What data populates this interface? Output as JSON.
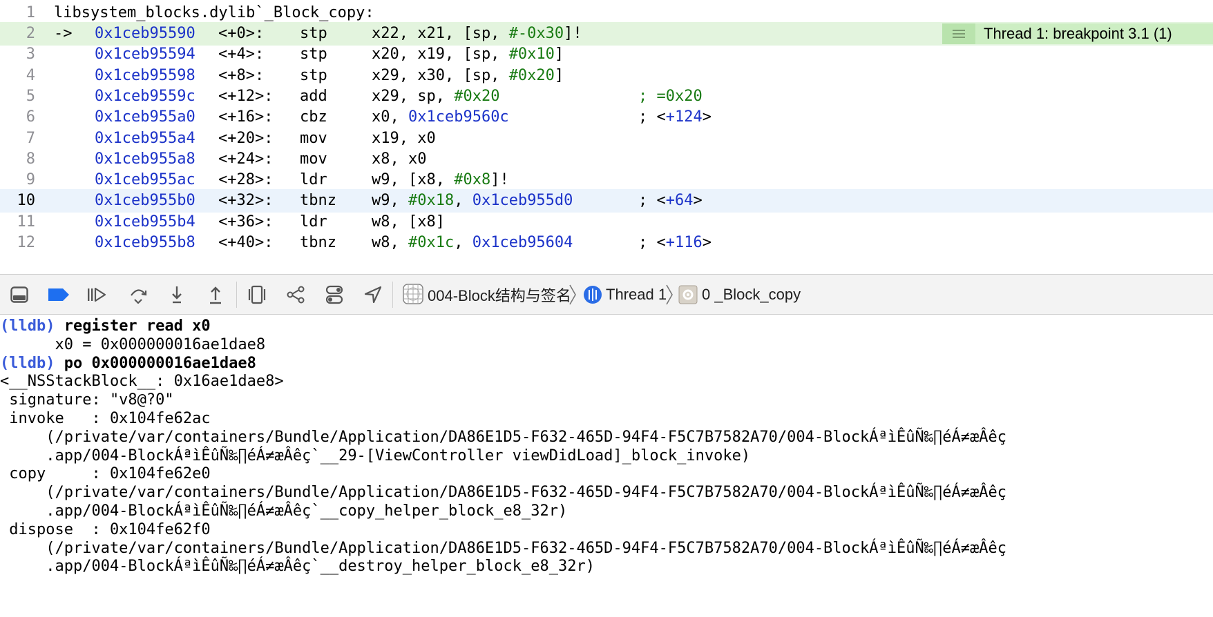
{
  "editor": {
    "header": {
      "line": "1",
      "text": "libsystem_blocks.dylib`_Block_copy:"
    },
    "pc_arrow": "->",
    "breakpoint_badge": "Thread 1: breakpoint 3.1 (1)",
    "rows": [
      {
        "line": "2",
        "addr": "0x1ceb95590",
        "offset": "<+0>:",
        "mnemonic": "stp",
        "ops": [
          "x22, x21, [sp, ",
          "#-0x30",
          "]!"
        ],
        "comment": ""
      },
      {
        "line": "3",
        "addr": "0x1ceb95594",
        "offset": "<+4>:",
        "mnemonic": "stp",
        "ops": [
          "x20, x19, [sp, ",
          "#0x10",
          "]"
        ],
        "comment": ""
      },
      {
        "line": "4",
        "addr": "0x1ceb95598",
        "offset": "<+8>:",
        "mnemonic": "stp",
        "ops": [
          "x29, x30, [sp, ",
          "#0x20",
          "]"
        ],
        "comment": ""
      },
      {
        "line": "5",
        "addr": "0x1ceb9559c",
        "offset": "<+12>:",
        "mnemonic": "add",
        "ops": [
          "x29, sp, ",
          "#0x20",
          ""
        ],
        "comment": "; =0x20"
      },
      {
        "line": "6",
        "addr": "0x1ceb955a0",
        "offset": "<+16>:",
        "mnemonic": "cbz",
        "ops": [
          "x0, ",
          "",
          ""
        ],
        "target": "0x1ceb9560c",
        "comment": "; <+124>"
      },
      {
        "line": "7",
        "addr": "0x1ceb955a4",
        "offset": "<+20>:",
        "mnemonic": "mov",
        "ops": [
          "x19, x0",
          "",
          ""
        ],
        "comment": ""
      },
      {
        "line": "8",
        "addr": "0x1ceb955a8",
        "offset": "<+24>:",
        "mnemonic": "mov",
        "ops": [
          "x8, x0",
          "",
          ""
        ],
        "comment": ""
      },
      {
        "line": "9",
        "addr": "0x1ceb955ac",
        "offset": "<+28>:",
        "mnemonic": "ldr",
        "ops": [
          "w9, [x8, ",
          "#0x8",
          "]!"
        ],
        "comment": ""
      },
      {
        "line": "10",
        "addr": "0x1ceb955b0",
        "offset": "<+32>:",
        "mnemonic": "tbnz",
        "ops": [
          "w9, ",
          "#0x18",
          ", "
        ],
        "target": "0x1ceb955d0",
        "comment": "; <+64>"
      },
      {
        "line": "11",
        "addr": "0x1ceb955b4",
        "offset": "<+36>:",
        "mnemonic": "ldr",
        "ops": [
          "w8, [x8]",
          "",
          ""
        ],
        "comment": ""
      },
      {
        "line": "12",
        "addr": "0x1ceb955b8",
        "offset": "<+40>:",
        "mnemonic": "tbnz",
        "ops": [
          "w8, ",
          "#0x1c",
          ", "
        ],
        "target": "0x1ceb95604",
        "comment": "; <+116>"
      }
    ]
  },
  "toolbar": {
    "breadcrumb": {
      "project": "004-Block结构与签名",
      "thread": "Thread 1",
      "frame": "0 _Block_copy"
    },
    "icons": [
      "hide-debug-area-icon",
      "breakpoints-toggle-icon",
      "continue-icon",
      "step-over-icon",
      "step-into-icon",
      "step-out-icon",
      "view-hierarchy-icon",
      "memory-graph-icon",
      "environment-overrides-icon",
      "simulate-location-icon",
      "app-icon",
      "thread-icon",
      "stack-frame-icon"
    ]
  },
  "console": {
    "lines": [
      {
        "prompt": "(lldb) ",
        "cmd": "register read x0",
        "text": ""
      },
      {
        "prompt": "",
        "cmd": "",
        "text": "      x0 = 0x000000016ae1dae8"
      },
      {
        "prompt": "(lldb) ",
        "cmd": "po 0x000000016ae1dae8",
        "text": ""
      },
      {
        "prompt": "",
        "cmd": "",
        "text": "<__NSStackBlock__: 0x16ae1dae8>"
      },
      {
        "prompt": "",
        "cmd": "",
        "text": " signature: \"v8@?0\""
      },
      {
        "prompt": "",
        "cmd": "",
        "text": " invoke   : 0x104fe62ac"
      },
      {
        "prompt": "",
        "cmd": "",
        "text": "     (/private/var/containers/Bundle/Application/DA86E1D5-F632-465D-94F4-F5C7B7582A70/004-BlockÁªìÊûÑ‰∏éÁ≠æÂêç"
      },
      {
        "prompt": "",
        "cmd": "",
        "text": "     .app/004-BlockÁªìÊûÑ‰∏éÁ≠æÂêç`__29-[ViewController viewDidLoad]_block_invoke)"
      },
      {
        "prompt": "",
        "cmd": "",
        "text": " copy     : 0x104fe62e0"
      },
      {
        "prompt": "",
        "cmd": "",
        "text": "     (/private/var/containers/Bundle/Application/DA86E1D5-F632-465D-94F4-F5C7B7582A70/004-BlockÁªìÊûÑ‰∏éÁ≠æÂêç"
      },
      {
        "prompt": "",
        "cmd": "",
        "text": "     .app/004-BlockÁªìÊûÑ‰∏éÁ≠æÂêç`__copy_helper_block_e8_32r)"
      },
      {
        "prompt": "",
        "cmd": "",
        "text": " dispose  : 0x104fe62f0"
      },
      {
        "prompt": "",
        "cmd": "",
        "text": "     (/private/var/containers/Bundle/Application/DA86E1D5-F632-465D-94F4-F5C7B7582A70/004-BlockÁªìÊûÑ‰∏éÁ≠æÂêç"
      },
      {
        "prompt": "",
        "cmd": "",
        "text": "     .app/004-BlockÁªìÊûÑ‰∏éÁ≠æÂêç`__destroy_helper_block_e8_32r)"
      }
    ]
  },
  "colors": {
    "address_blue": "#1c33c9",
    "immediate_green": "#187a12",
    "pc_line_bg": "#e3f4de",
    "current_line_bg": "#ebf3fc",
    "breakpoint_badge_bg": "#cdeec3",
    "lldb_prompt": "#3a5bd9",
    "active_toolbar_blue": "#1e6ff0"
  }
}
